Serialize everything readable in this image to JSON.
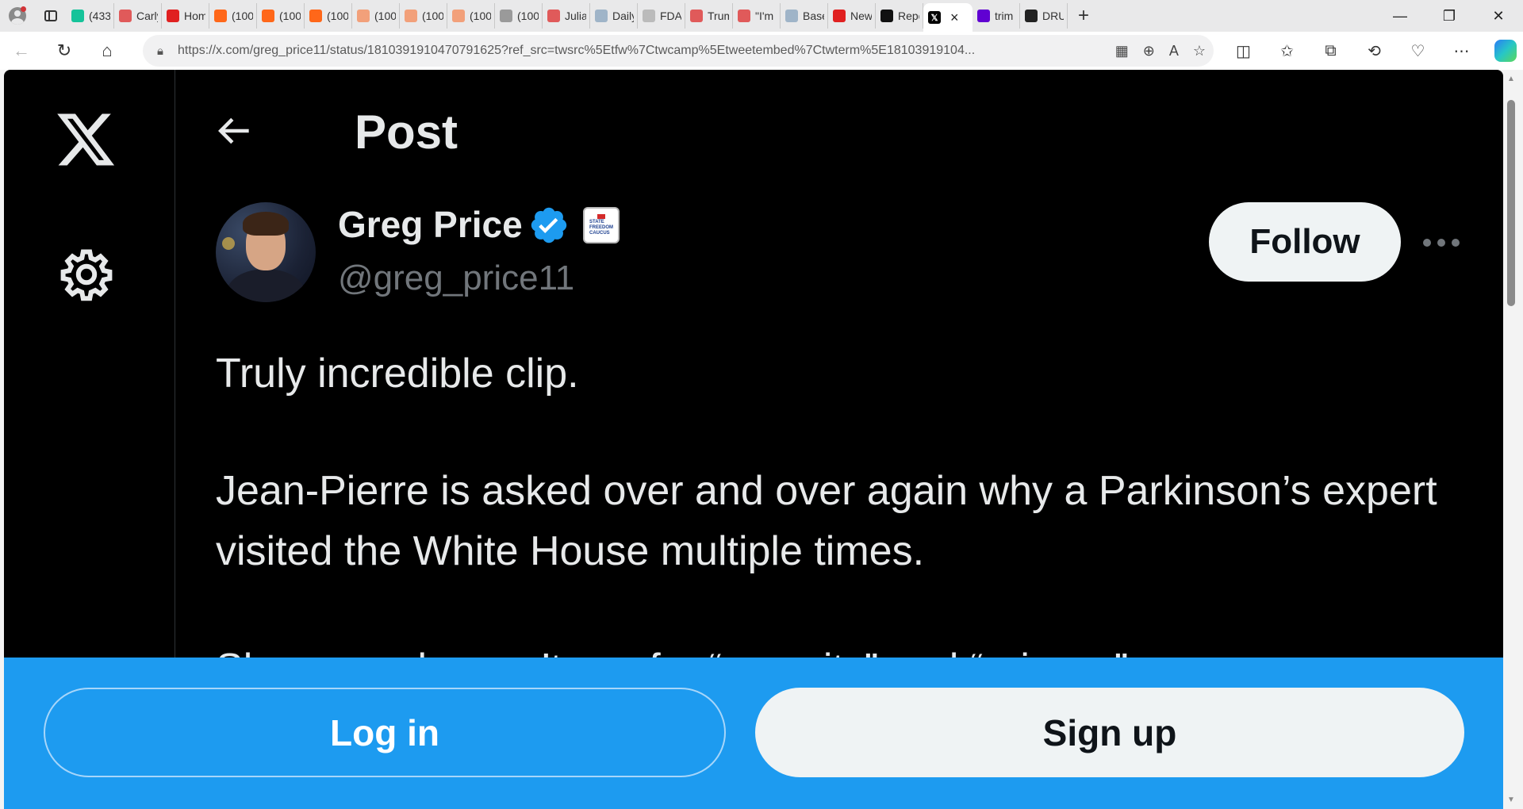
{
  "browser": {
    "tabs": [
      {
        "label": "(433",
        "icon": "grammarly-icon",
        "color": "#15c39a"
      },
      {
        "label": "Carly",
        "icon": "youtube-icon",
        "color": "#e05a5a"
      },
      {
        "label": "Hom",
        "icon": "news-icon",
        "color": "#e02020"
      },
      {
        "label": "(100",
        "icon": "substack-icon",
        "color": "#ff6719"
      },
      {
        "label": "(100",
        "icon": "substack-icon",
        "color": "#ff6719"
      },
      {
        "label": "(100",
        "icon": "substack-icon",
        "color": "#ff6719"
      },
      {
        "label": "(100",
        "icon": "substack-icon",
        "color": "#f2a07a"
      },
      {
        "label": "(100",
        "icon": "substack-icon",
        "color": "#f2a07a"
      },
      {
        "label": "(100",
        "icon": "substack-icon",
        "color": "#f2a07a"
      },
      {
        "label": "(100",
        "icon": "image-icon",
        "color": "#9a9a9a"
      },
      {
        "label": "Julia",
        "icon": "youtube-icon",
        "color": "#e05a5a"
      },
      {
        "label": "Daily",
        "icon": "shield-icon",
        "color": "#9fb4c8"
      },
      {
        "label": "FDA",
        "icon": "document-icon",
        "color": "#bbbbbb"
      },
      {
        "label": "Trum",
        "icon": "youtube-icon",
        "color": "#e05a5a"
      },
      {
        "label": "\"I'm",
        "icon": "youtube-icon",
        "color": "#e05a5a"
      },
      {
        "label": "Base",
        "icon": "shield-icon",
        "color": "#9fb4c8"
      },
      {
        "label": "New",
        "icon": "r-icon",
        "color": "#e02020"
      },
      {
        "label": "Repo",
        "icon": "h-icon",
        "color": "#111111"
      }
    ],
    "active_tab": {
      "icon": "x-icon",
      "close": "×"
    },
    "tabs_after": [
      {
        "label": "trim",
        "icon": "yahoo-icon",
        "color": "#6001d2"
      },
      {
        "label": "DRU",
        "icon": "drudge-icon",
        "color": "#222222"
      }
    ],
    "new_tab": "+",
    "window_controls": [
      "—",
      "❐",
      "✕"
    ],
    "url": "https://x.com/greg_price11/status/1810391910470791625?ref_src=twsrc%5Etfw%7Ctwcamp%5Etweetembed%7Ctwterm%5E18103919104...",
    "nav": {
      "back": "←",
      "refresh": "↻",
      "home": "⌂"
    }
  },
  "x_page": {
    "header_title": "Post",
    "author": {
      "name": "Greg Price",
      "handle": "@greg_price11",
      "badge_text": "STATE FREEDOM CAUCUS"
    },
    "follow_label": "Follow",
    "post_lines": [
      "Truly incredible clip.",
      "Jean-Pierre is asked over and over again why a Parkinson’s expert visited the White House multiple times.",
      "She says she can’t say for “security” and “privacy”"
    ]
  },
  "bottom_bar": {
    "login_label": "Log in",
    "signup_label": "Sign up"
  },
  "colors": {
    "x_background": "#000000",
    "x_text": "#e7e9ea",
    "x_secondary": "#71767b",
    "x_blue": "#1d9bf0"
  }
}
